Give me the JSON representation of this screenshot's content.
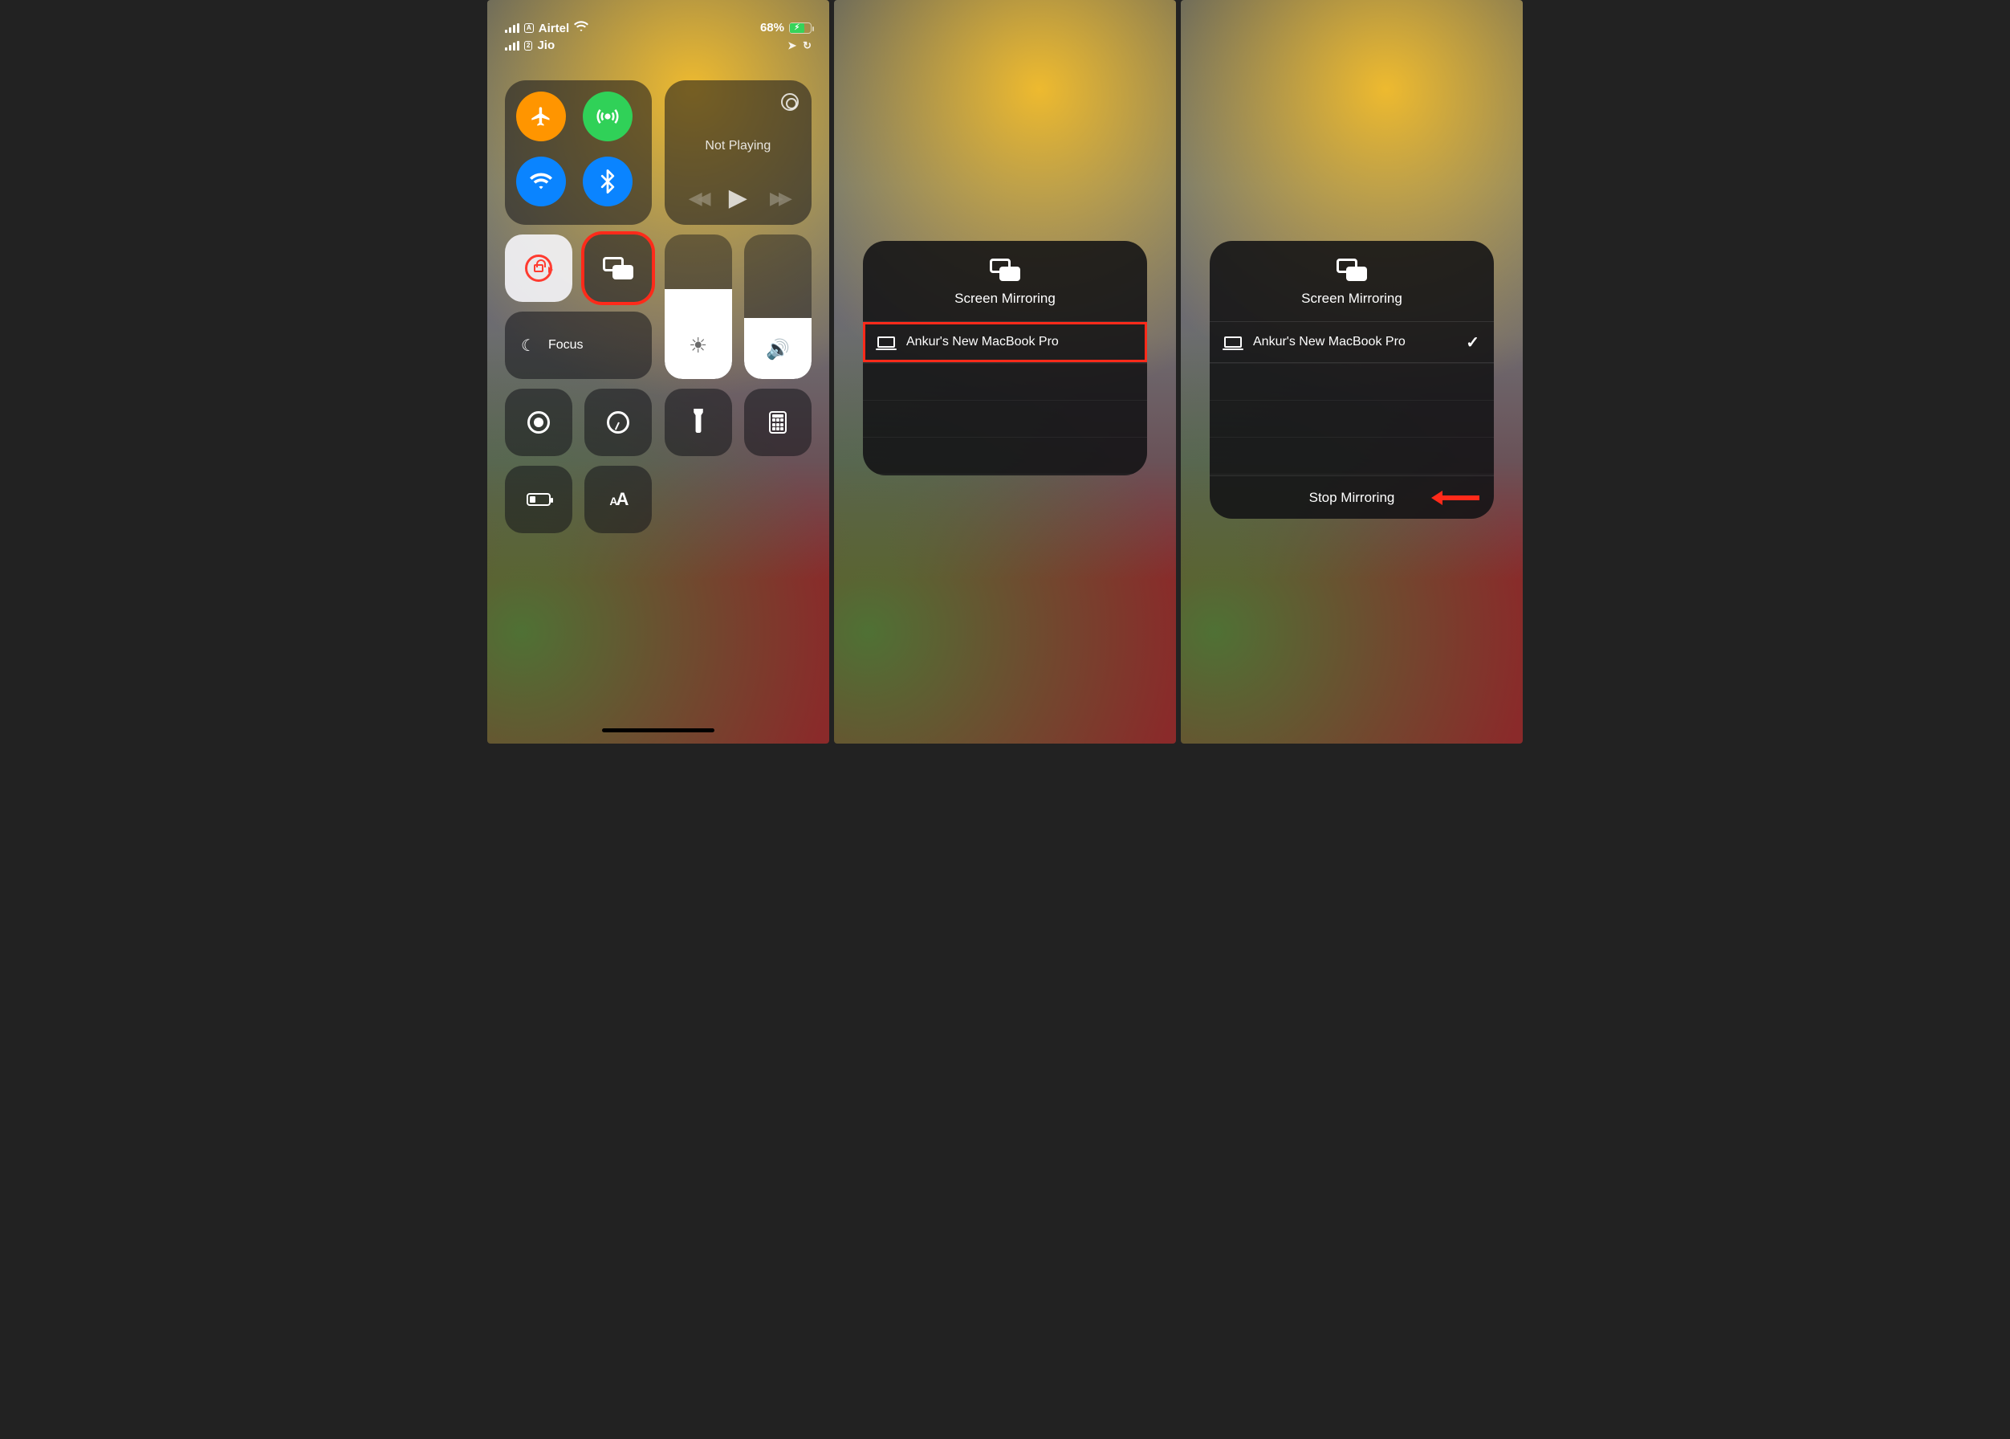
{
  "status": {
    "sim1_label": "A",
    "carrier1": "Airtel",
    "sim2_label": "2",
    "carrier2": "Jio",
    "battery_pct": "68%"
  },
  "media": {
    "now_playing": "Not Playing"
  },
  "cc": {
    "focus_label": "Focus"
  },
  "mirror_modal": {
    "title": "Screen Mirroring",
    "device_name": "Ankur's New MacBook Pro",
    "stop_label": "Stop Mirroring"
  }
}
